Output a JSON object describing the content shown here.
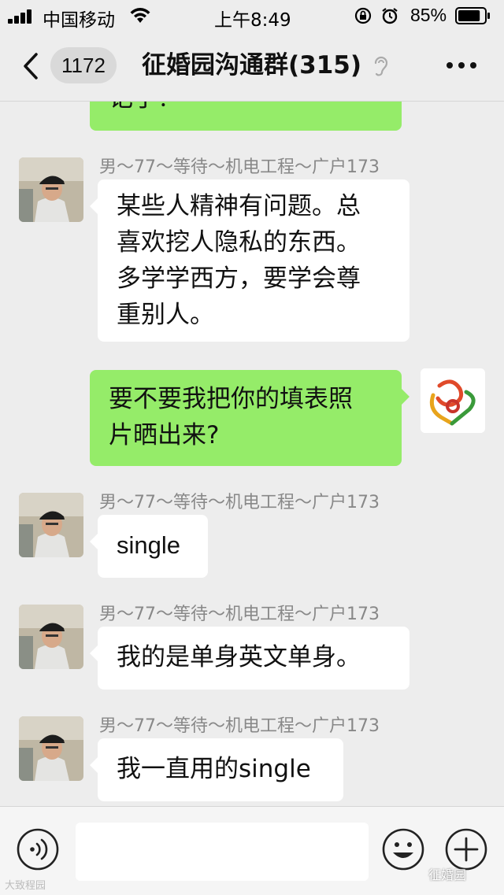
{
  "status_bar": {
    "carrier": "中国移动",
    "time": "上午8:49",
    "battery_percent": "85%",
    "battery_level": 0.85
  },
  "nav": {
    "unread_count": "1172",
    "title": "征婚园沟通群(315)"
  },
  "messages": [
    {
      "direction": "out",
      "text": "记了？"
    },
    {
      "direction": "in",
      "sender": "男～77～等待～机电工程～广户173",
      "lines": [
        "某些人精神有问题。总",
        "喜欢挖人隐私的东西。",
        "多学学西方，要学会尊",
        "重别人。"
      ]
    },
    {
      "direction": "out",
      "lines": [
        "要不要我把你的填表照",
        "片晒出来?"
      ]
    },
    {
      "direction": "in",
      "sender": "男～77～等待～机电工程～广户173",
      "text": "single"
    },
    {
      "direction": "in",
      "sender": "男～77～等待～机电工程～广户173",
      "text": "我的是单身英文单身。"
    },
    {
      "direction": "in",
      "sender": "男～77～等待～机电工程～广户173",
      "text": "我一直用的single"
    }
  ],
  "input": {
    "placeholder": ""
  },
  "watermarks": {
    "left": "大致程园",
    "right": "征婚园"
  },
  "colors": {
    "outgoing_bubble": "#95ec69",
    "incoming_bubble": "#ffffff",
    "background": "#ededed"
  }
}
